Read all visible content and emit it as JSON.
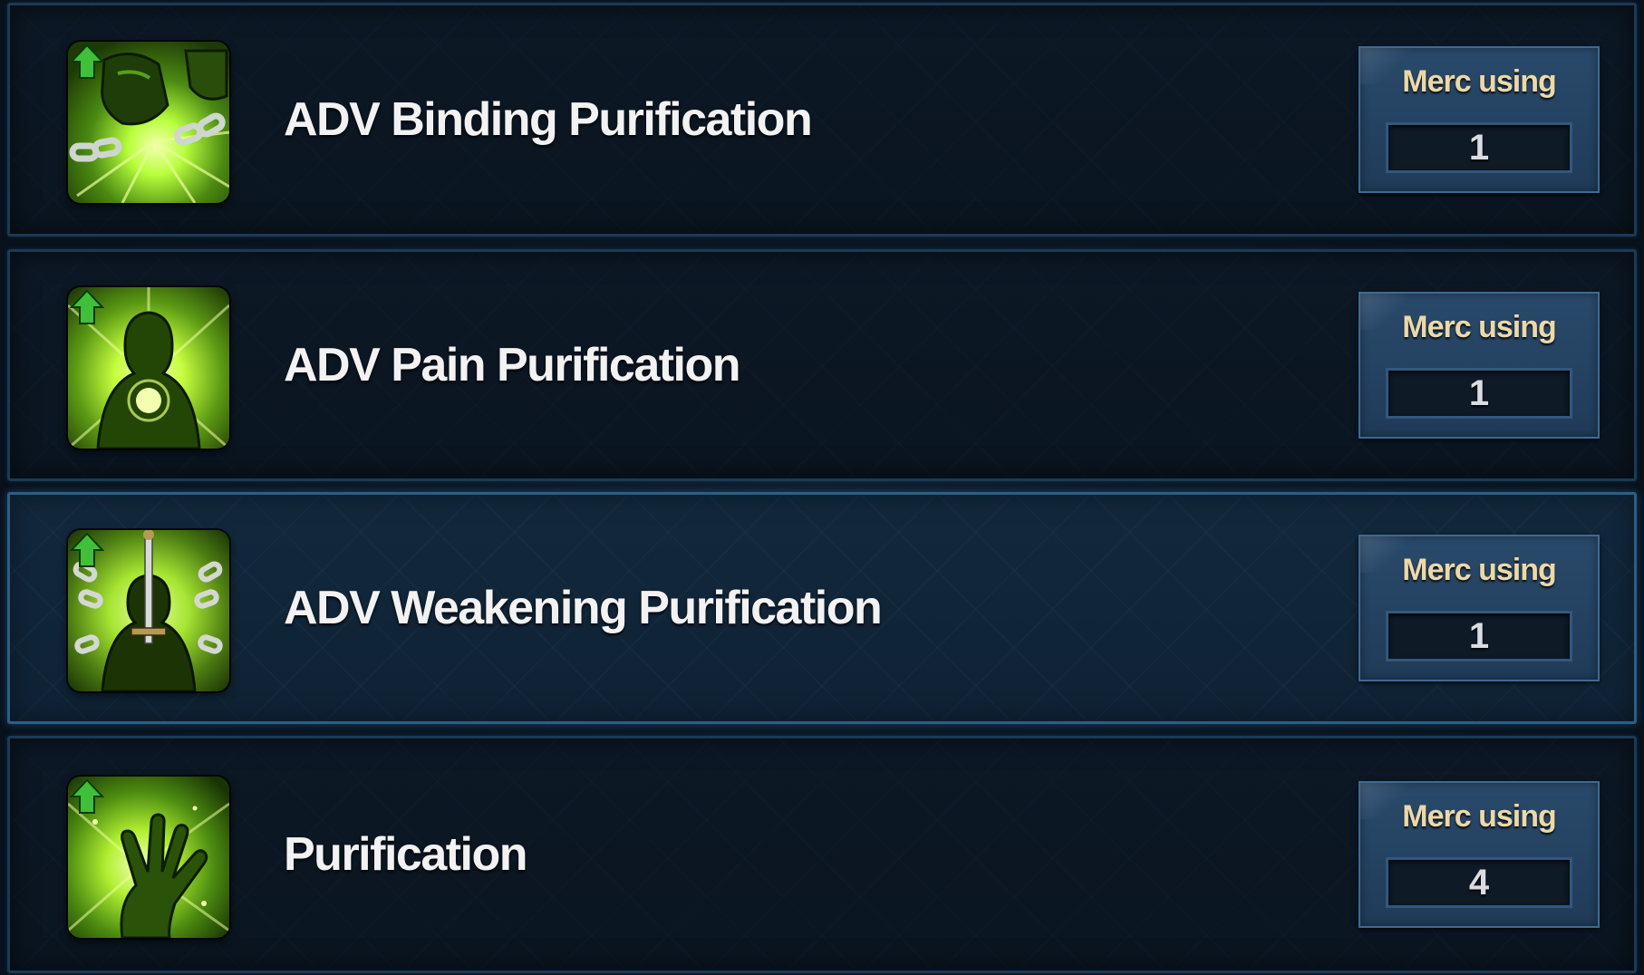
{
  "skills": [
    {
      "name": "ADV Binding Purification",
      "icon": "binding-purification-icon",
      "merc_label": "Merc using",
      "merc_count": "1",
      "upgrade_indicator": "up-arrow-icon",
      "selected": false
    },
    {
      "name": "ADV Pain Purification",
      "icon": "pain-purification-icon",
      "merc_label": "Merc using",
      "merc_count": "1",
      "upgrade_indicator": "up-arrow-icon",
      "selected": false
    },
    {
      "name": "ADV Weakening Purification",
      "icon": "weakening-purification-icon",
      "merc_label": "Merc using",
      "merc_count": "1",
      "upgrade_indicator": "up-arrow-icon",
      "selected": true
    },
    {
      "name": "Purification",
      "icon": "purification-icon",
      "merc_label": "Merc using",
      "merc_count": "4",
      "upgrade_indicator": "up-arrow-icon",
      "selected": false
    }
  ],
  "colors": {
    "background": "#08111c",
    "row_border": "#1b3a56",
    "selected_border": "#2b5f85",
    "skill_name": "#f2f2f2",
    "merc_label": "#ecd9a8",
    "merc_panel": "#2a4a6b",
    "icon_glow": "#b8ff3c",
    "upgrade_arrow": "#3fbf3a"
  }
}
